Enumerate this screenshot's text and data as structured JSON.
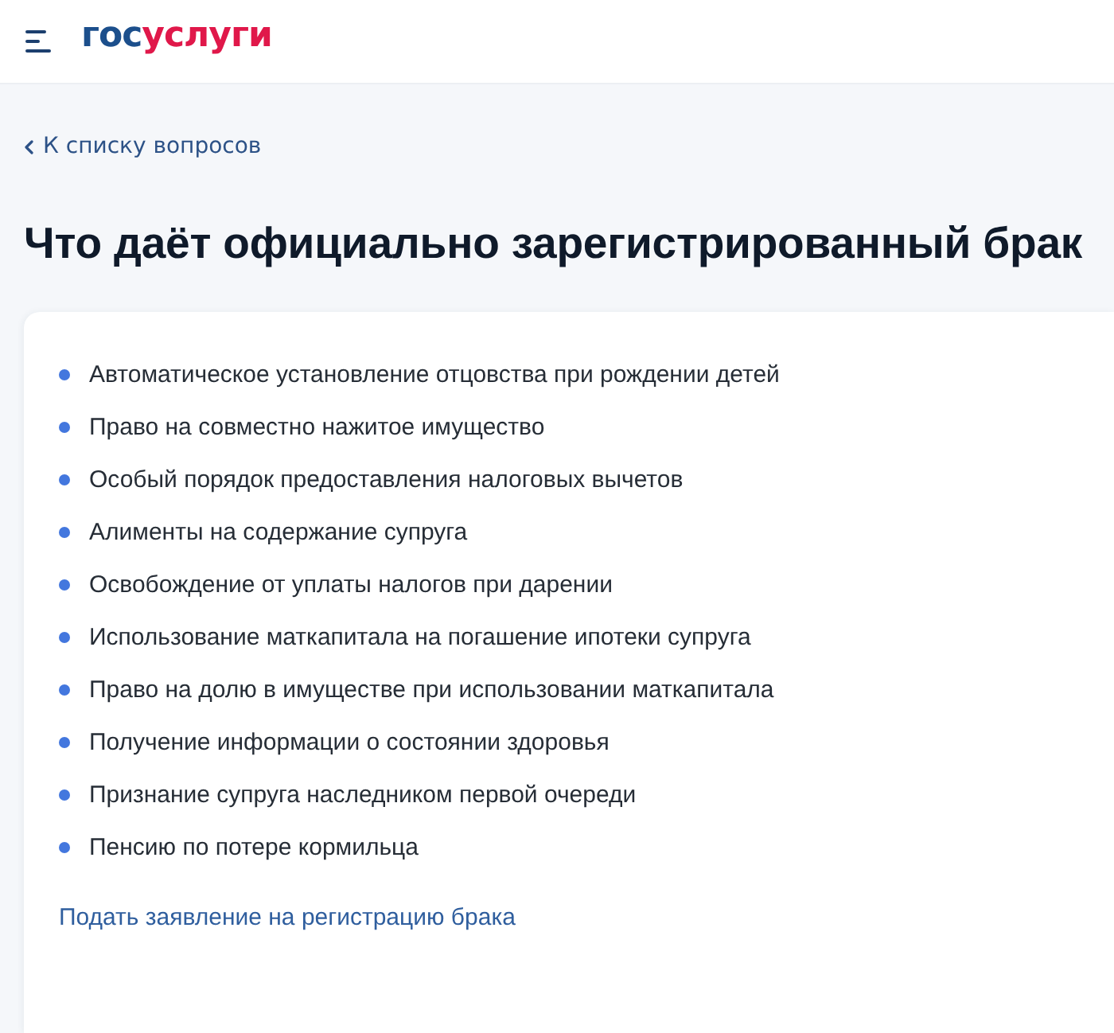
{
  "header": {
    "logo": {
      "first_part": "гос",
      "second_part": "услуги"
    }
  },
  "back_link": {
    "label": "К списку вопросов"
  },
  "title": "Что даёт официально зарегистрированный брак",
  "benefits": [
    "Автоматическое установление отцовства при рождении детей",
    "Право на совместно нажитое имущество",
    "Особый порядок предоставления налоговых вычетов",
    "Алименты на содержание супруга",
    "Освобождение от уплаты налогов при дарении",
    "Использование маткапитала на погашение ипотеки супруга",
    "Право на долю в имуществе при использовании маткапитала",
    "Получение информации о состоянии здоровья",
    "Признание супруга наследником первой очереди",
    "Пенсию по потере кормильца"
  ],
  "action_link": {
    "label": "Подать заявление на регистрацию брака"
  }
}
